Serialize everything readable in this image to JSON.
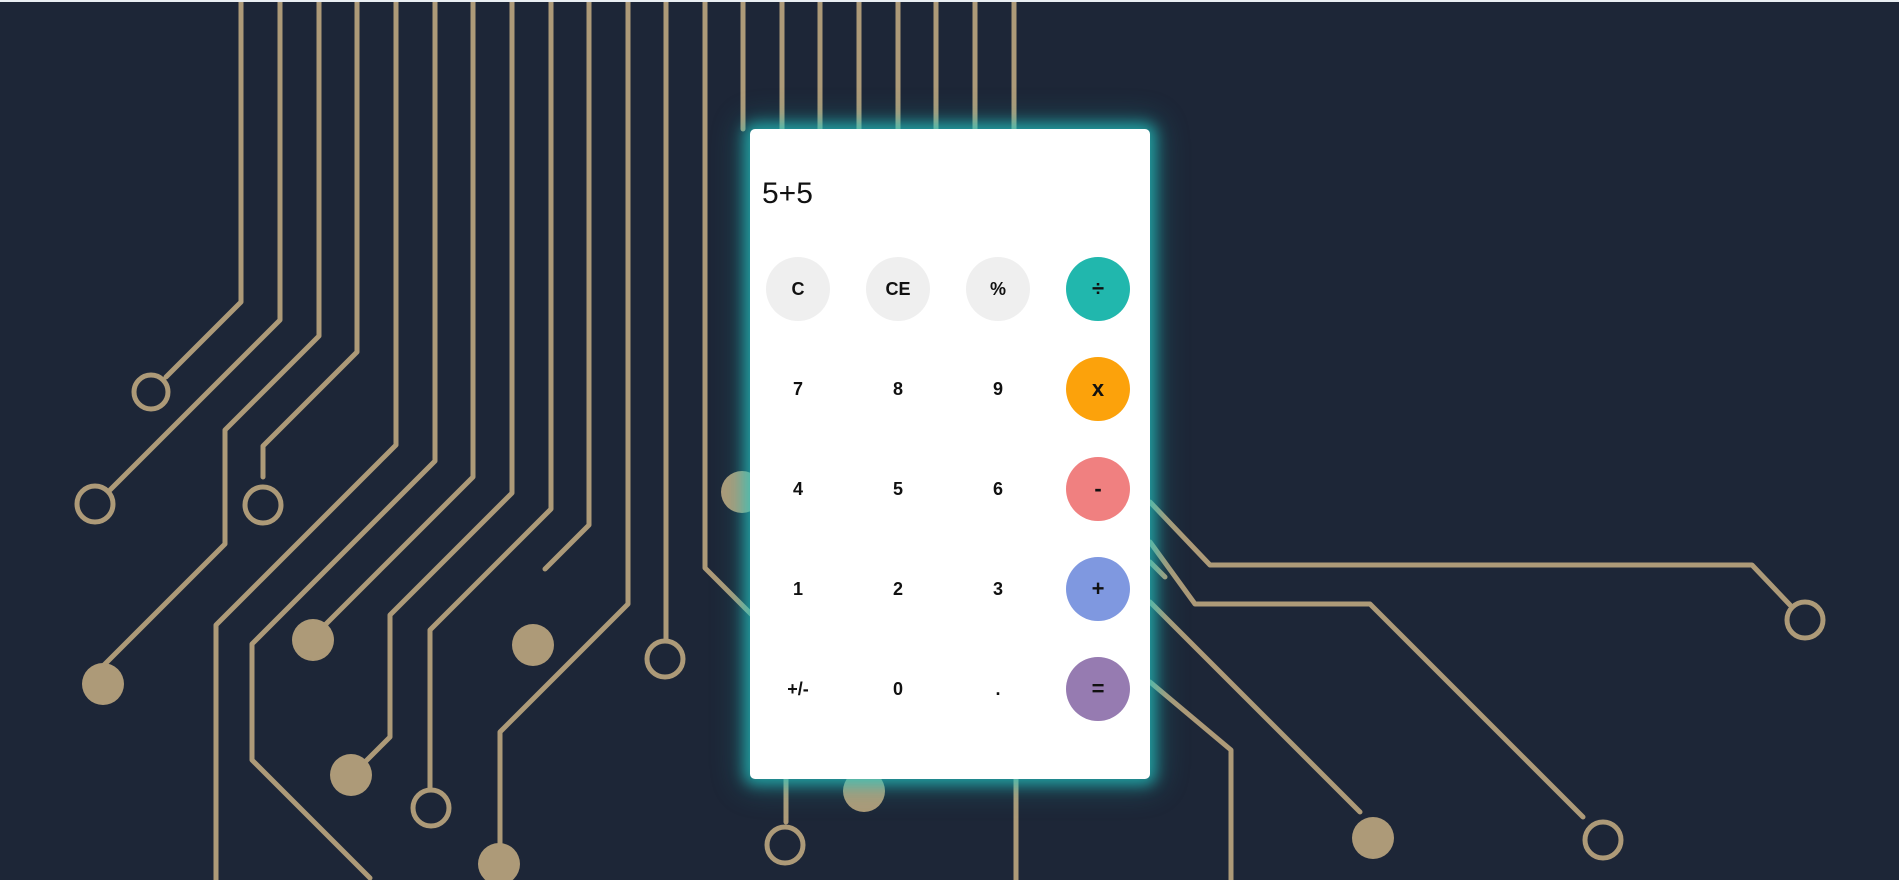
{
  "display": {
    "expression": "5+5"
  },
  "keypad": {
    "rows": [
      [
        {
          "label": "C",
          "name": "clear-button",
          "style": "gray"
        },
        {
          "label": "CE",
          "name": "clear-entry-button",
          "style": "gray"
        },
        {
          "label": "%",
          "name": "percent-button",
          "style": "gray"
        },
        {
          "label": "÷",
          "name": "divide-button",
          "style": "op",
          "color": "#21b7ad"
        }
      ],
      [
        {
          "label": "7",
          "name": "digit-7-button",
          "style": "plain"
        },
        {
          "label": "8",
          "name": "digit-8-button",
          "style": "plain"
        },
        {
          "label": "9",
          "name": "digit-9-button",
          "style": "plain"
        },
        {
          "label": "x",
          "name": "multiply-button",
          "style": "op",
          "color": "#fca20b"
        }
      ],
      [
        {
          "label": "4",
          "name": "digit-4-button",
          "style": "plain"
        },
        {
          "label": "5",
          "name": "digit-5-button",
          "style": "plain"
        },
        {
          "label": "6",
          "name": "digit-6-button",
          "style": "plain"
        },
        {
          "label": "-",
          "name": "subtract-button",
          "style": "op",
          "color": "#f08080"
        }
      ],
      [
        {
          "label": "1",
          "name": "digit-1-button",
          "style": "plain"
        },
        {
          "label": "2",
          "name": "digit-2-button",
          "style": "plain"
        },
        {
          "label": "3",
          "name": "digit-3-button",
          "style": "plain"
        },
        {
          "label": "+",
          "name": "add-button",
          "style": "op",
          "color": "#7f98e0"
        }
      ],
      [
        {
          "label": "+/-",
          "name": "toggle-sign-button",
          "style": "plain"
        },
        {
          "label": "0",
          "name": "digit-0-button",
          "style": "plain"
        },
        {
          "label": ".",
          "name": "decimal-button",
          "style": "plain"
        },
        {
          "label": "=",
          "name": "equals-button",
          "style": "op",
          "color": "#967bb1"
        }
      ]
    ]
  },
  "theme": {
    "background": "#1d2637",
    "circuit": "#ad9a78",
    "glow": "#24cbc8",
    "panel": "#ffffff"
  }
}
